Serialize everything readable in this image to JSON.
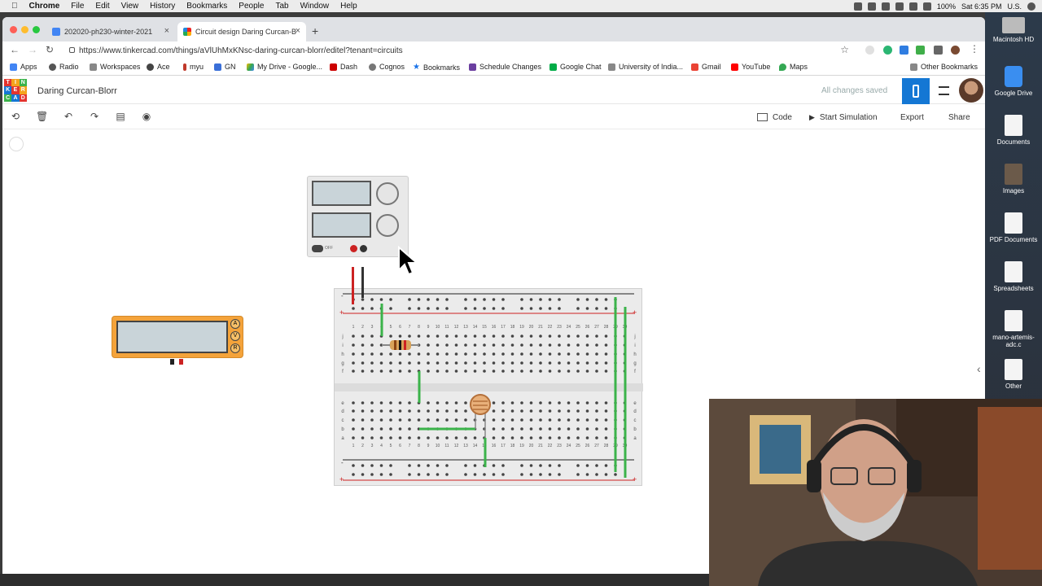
{
  "menubar": {
    "app": "Chrome",
    "items": [
      "File",
      "Edit",
      "View",
      "History",
      "Bookmarks",
      "People",
      "Tab",
      "Window",
      "Help"
    ],
    "battery": "100%",
    "clock": "Sat 6:35 PM",
    "locale": "U.S."
  },
  "tabs": [
    {
      "label": "202020-ph230-winter-2021",
      "active": false
    },
    {
      "label": "Circuit design Daring Curcan-B",
      "active": true
    }
  ],
  "omnibox": {
    "url": "https://www.tinkercad.com/things/aVlUhMxKNsc-daring-curcan-blorr/editel?tenant=circuits"
  },
  "bookmarks": [
    "Apps",
    "Radio",
    "Workspaces",
    "Ace",
    "myu",
    "GN",
    "My Drive - Google...",
    "Dash",
    "Cognos",
    "Bookmarks",
    "Schedule Changes",
    "Google Chat",
    "University of India...",
    "Gmail",
    "YouTube",
    "Maps"
  ],
  "other_bookmarks": "Other Bookmarks",
  "tinkercad": {
    "logo": [
      "TIN",
      "KER",
      "CAD"
    ],
    "logo_letters": [
      "T",
      "I",
      "N",
      "K",
      "E",
      "R",
      "C",
      "A",
      "D"
    ],
    "design_title": "Daring Curcan-Blorr",
    "save_status": "All changes saved",
    "buttons": {
      "code": "Code",
      "simulate": "Start Simulation",
      "export": "Export",
      "share": "Share"
    }
  },
  "components": {
    "power_supply_off_label": "OFF",
    "multimeter_buttons": [
      "A",
      "V",
      "R"
    ]
  },
  "breadboard": {
    "column_numbers": [
      "1",
      "2",
      "3",
      "4",
      "5",
      "6",
      "7",
      "8",
      "9",
      "10",
      "11",
      "12",
      "13",
      "14",
      "15",
      "16",
      "17",
      "18",
      "19",
      "20",
      "21",
      "22",
      "23",
      "24",
      "25",
      "26",
      "27",
      "28",
      "29",
      "30"
    ],
    "top_rows": [
      "j",
      "i",
      "h",
      "g",
      "f"
    ],
    "bottom_rows": [
      "e",
      "d",
      "c",
      "b",
      "a"
    ],
    "rail_plus": "+",
    "rail_minus": "-"
  },
  "desktop": {
    "items": [
      "Macintosh HD",
      "Google Drive",
      "Documents",
      "Images",
      "PDF Documents",
      "Spreadsheets",
      "mano-artemis-adc.c",
      "Other"
    ]
  },
  "colors": {
    "tinkercad_blue": "#1477d4",
    "multimeter_orange": "#f4a33a",
    "wire_green": "#3bb34a",
    "wire_red": "#cc2020"
  }
}
